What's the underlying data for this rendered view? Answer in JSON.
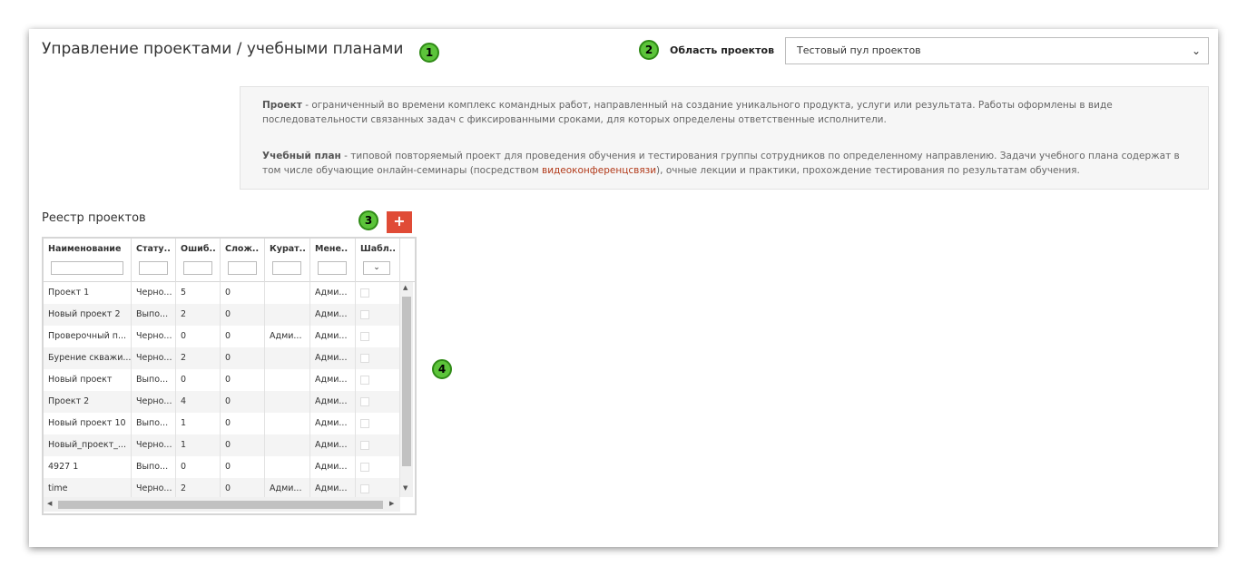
{
  "header": {
    "title": "Управление проектами / учебными планами",
    "area_label": "Область проектов",
    "area_select_value": "Тестовый пул проектов"
  },
  "badges": [
    "1",
    "2",
    "3",
    "4"
  ],
  "info": {
    "project_term": "Проект",
    "project_text": " - ограниченный во времени комплекс командных работ, направленный на создание уникального продукта, услуги или результата. Работы оформлены в виде последовательности связанных задач с фиксированными сроками, для которых определены ответственные исполнители.",
    "plan_term": "Учебный план",
    "plan_text_1": " - типовой повторяемый проект для проведения обучения и тестирования группы сотрудников по определенному направлению. Задачи учебного плана содержат в том числе обучающие онлайн-семинары (посредством ",
    "plan_link": "видеоконференцсвязи",
    "plan_text_2": "), очные лекции и практики, прохождение тестирования по результатам обучения."
  },
  "registry": {
    "title": "Реестр проектов",
    "add_label": "+",
    "columns": [
      "Наименование",
      "Стату..",
      "Ошиб..",
      "Слож..",
      "Курат..",
      "Мене..",
      "Шабл.."
    ],
    "rows": [
      [
        "Проект 1",
        "Черно...",
        "5",
        "0",
        "",
        "Адми..."
      ],
      [
        "Новый проект 2",
        "Выпо...",
        "2",
        "0",
        "",
        "Адми..."
      ],
      [
        "Проверочный п...",
        "Черно...",
        "0",
        "0",
        "Адми...",
        "Адми..."
      ],
      [
        "Бурение скважи...",
        "Черно...",
        "2",
        "0",
        "",
        "Адми..."
      ],
      [
        "Новый проект",
        "Выпо...",
        "0",
        "0",
        "",
        "Адми..."
      ],
      [
        "Проект 2",
        "Черно...",
        "4",
        "0",
        "",
        "Адми..."
      ],
      [
        "Новый проект 10",
        "Выпо...",
        "1",
        "0",
        "",
        "Адми..."
      ],
      [
        "Новый_проект_...",
        "Черно...",
        "1",
        "0",
        "",
        "Адми..."
      ],
      [
        "4927 1",
        "Выпо...",
        "0",
        "0",
        "",
        "Адми..."
      ],
      [
        "time",
        "Черно...",
        "2",
        "0",
        "Адми...",
        "Адми..."
      ]
    ]
  },
  "colors": {
    "accent_red": "#e04b36",
    "badge_green": "#5cc43a",
    "link": "#b23a1a"
  }
}
